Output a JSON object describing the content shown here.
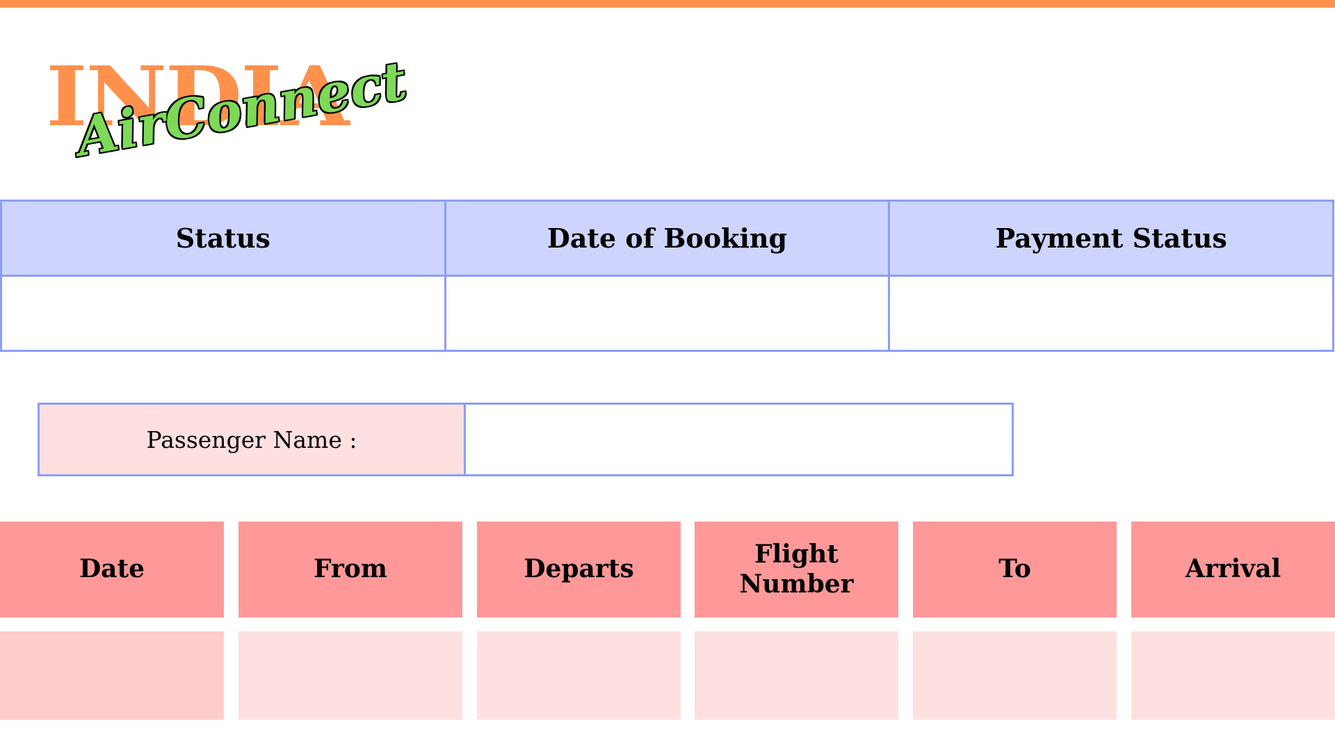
{
  "colors": {
    "accent_orange": "#FF914D",
    "logo_green": "#7ED957",
    "table_border": "#8C9EF5",
    "table_header": "#CDD5FE",
    "flight_header": "#FF9999",
    "flight_cell": "#FFE0E0",
    "passenger_label_bg": "#FFE0E0"
  },
  "logo": {
    "main": "INDIA",
    "script": "AirConnect"
  },
  "status_table": {
    "headers": [
      "Status",
      "Date of Booking",
      "Payment Status"
    ],
    "values": [
      "",
      "",
      ""
    ]
  },
  "passenger": {
    "label": "Passenger Name :",
    "value": ""
  },
  "flight_table": {
    "headers": [
      "Date",
      "From",
      "Departs",
      "Flight Number",
      "To",
      "Arrival"
    ],
    "values": [
      "",
      "",
      "",
      "",
      "",
      ""
    ]
  }
}
